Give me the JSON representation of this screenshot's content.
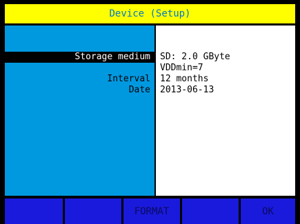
{
  "title": "Device (Setup)",
  "fields": [
    {
      "label": "Storage medium",
      "value": "SD: 2.0 GByte"
    },
    {
      "label": "",
      "value": "VDDmin=7"
    },
    {
      "label": "Interval",
      "value": "12 months"
    },
    {
      "label": "Date",
      "value": "2013-06-13"
    }
  ],
  "softkeys": [
    "",
    "",
    "FORMAT",
    "",
    "OK"
  ],
  "colors": {
    "title_bg": "#ffff00",
    "title_text": "#0078c8",
    "label_panel": "#0099e0",
    "value_panel": "#ffffff",
    "softkey": "#1a1adc",
    "selection": "#000000"
  }
}
